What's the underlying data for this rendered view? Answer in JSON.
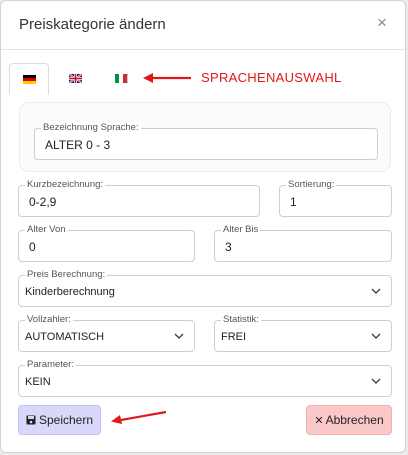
{
  "dialog": {
    "title": "Preiskategorie ändern",
    "close_symbol": "×"
  },
  "language_tabs": [
    {
      "language": "de",
      "flag": "german-flag-icon",
      "active": true
    },
    {
      "language": "en",
      "flag": "british-flag-icon",
      "active": false
    },
    {
      "language": "it",
      "flag": "italian-flag-icon",
      "active": false
    }
  ],
  "annotation": {
    "language_note": "SPRACHENAUSWAHL",
    "color": "#e01818"
  },
  "fields": {
    "bezeichnung": {
      "label": "Bezeichnung Sprache:",
      "value": "ALTER 0 - 3"
    },
    "kurzbezeichnung": {
      "label": "Kurzbezeichnung:",
      "value": "0-2,9"
    },
    "sortierung": {
      "label": "Sortierung:",
      "value": "1"
    },
    "alter_von": {
      "label": "Alter Von",
      "value": "0"
    },
    "alter_bis": {
      "label": "Alter Bis",
      "value": "3"
    },
    "preis_berechnung": {
      "label": "Preis Berechnung:",
      "value": "Kinderberechnung"
    },
    "vollzahler": {
      "label": "Vollzahler:",
      "value": "AUTOMATISCH"
    },
    "statistik": {
      "label": "Statistik:",
      "value": "FREI"
    },
    "parameter": {
      "label": "Parameter:",
      "value": "KEIN"
    }
  },
  "buttons": {
    "save": {
      "label": "Speichern",
      "icon": "floppy-disk-icon",
      "color": "#d9d8fb"
    },
    "cancel": {
      "label": "Abbrechen",
      "icon": "x-icon",
      "icon_glyph": "✕",
      "color": "#fbc8c8"
    }
  }
}
